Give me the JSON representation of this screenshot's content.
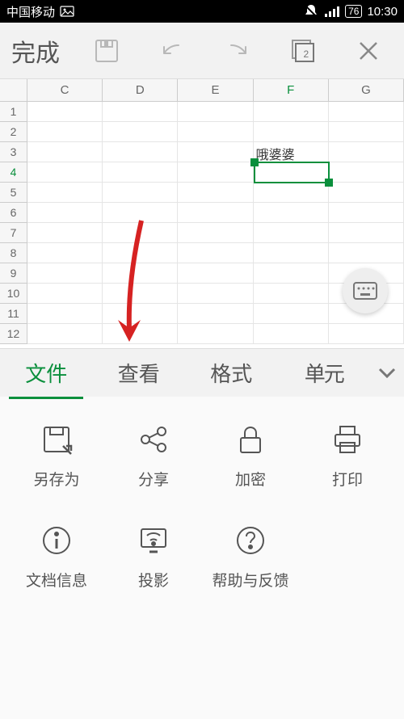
{
  "status": {
    "carrier": "中国移动",
    "battery": "76",
    "time": "10:30"
  },
  "toolbar": {
    "done": "完成",
    "sheets_count": "2"
  },
  "sheet": {
    "columns": [
      "C",
      "D",
      "E",
      "F",
      "G"
    ],
    "rows": [
      "1",
      "2",
      "3",
      "4",
      "5",
      "6",
      "7",
      "8",
      "9",
      "10",
      "11",
      "12"
    ],
    "selected_col": "F",
    "selected_row": "4",
    "cells": {
      "F3": "哦婆婆"
    }
  },
  "tabs": {
    "items": [
      "文件",
      "查看",
      "格式",
      "单元"
    ],
    "active_index": 0
  },
  "panel": {
    "items": [
      {
        "label": "另存为"
      },
      {
        "label": "分享"
      },
      {
        "label": "加密"
      },
      {
        "label": "打印"
      },
      {
        "label": "文档信息"
      },
      {
        "label": "投影"
      },
      {
        "label": "帮助与反馈"
      }
    ]
  }
}
